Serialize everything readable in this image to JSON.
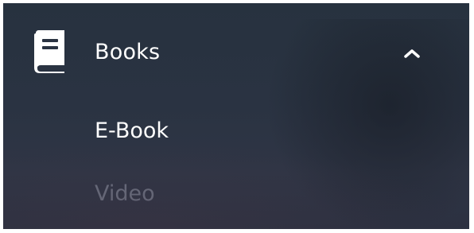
{
  "menu": {
    "header": {
      "label": "Books",
      "icon": "book-icon",
      "toggle_icon": "chevron-up-icon",
      "expanded": true
    },
    "items": [
      {
        "label": "E-Book",
        "state": "active"
      },
      {
        "label": "Video",
        "state": "inactive"
      }
    ]
  },
  "colors": {
    "background": "#2a3342",
    "text_active": "#ffffff",
    "text_inactive": "#6c7282"
  }
}
